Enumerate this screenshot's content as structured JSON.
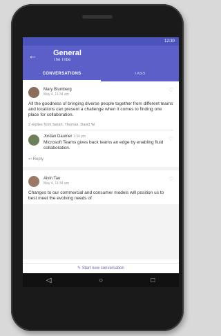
{
  "statusbar": {
    "time": "12:30"
  },
  "appbar": {
    "back_icon": "arrow-left-icon",
    "title": "General",
    "subtitle": "The Tribe"
  },
  "tabs": [
    {
      "label": "CONVERSATIONS"
    },
    {
      "label": "TABS"
    }
  ],
  "posts": [
    {
      "author": "Mary Blumberg",
      "time": "May 4, 11:34 am",
      "text": "All the goodness of bringing diverse people together from different teams and locations can present a challenge when it comes to finding one place for collaboration."
    },
    {
      "author": "Alvin Tao",
      "time": "May 4, 11:34 am",
      "text": "Changes to our commercial and consumer models will position us to best meet the evolving needs of"
    }
  ],
  "reply_note": "2 replies from Sarah, Thomas, David W.",
  "reply": {
    "author": "Jordan Daumer",
    "time": "1:34 pm",
    "text": "Microsoft Teams gives back teams an edge by enabling fluid collaboration."
  },
  "reply_action": "Reply",
  "composer": {
    "label": "Start new conversation"
  },
  "navbar": {
    "back": "◁",
    "home": "○",
    "recent": "□"
  }
}
